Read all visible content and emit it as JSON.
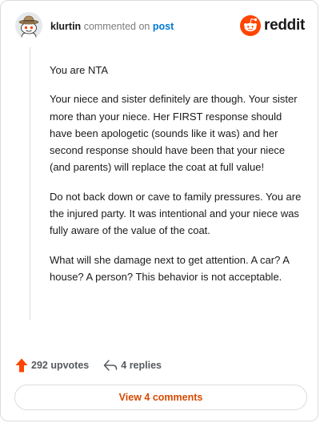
{
  "comment": {
    "username": "klurtin",
    "commented_on_text": "commented on",
    "post_link_label": "post",
    "paragraphs": [
      "You are NTA",
      "Your niece and sister definitely are though. Your sister more than your niece. Her FIRST response should have been apologetic (sounds like it was) and her second response should have been that your niece (and parents) will replace the coat at full value!",
      "Do not back down or cave to family pressures. You are the injured party. It was intentional and your niece was fully aware of the value of the coat.",
      "What will she damage next to get attention. A car? A house? A person? This behavior is not acceptable."
    ]
  },
  "brand": {
    "wordmark": "reddit",
    "icon": "reddit-snoo-icon",
    "color": "#ff4500"
  },
  "actions": {
    "upvotes_label": "292 upvotes",
    "upvote_icon": "upvote-arrow-icon",
    "upvote_color": "#ff4500",
    "replies_label": "4 replies",
    "reply_icon": "reply-arrow-icon"
  },
  "footer": {
    "view_comments_label": "View 4 comments",
    "accent_color": "#d84a00"
  }
}
